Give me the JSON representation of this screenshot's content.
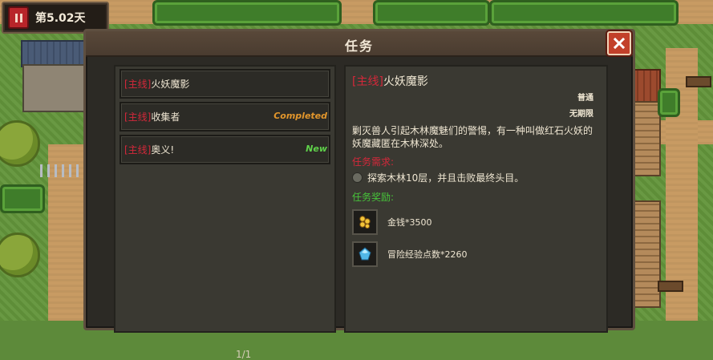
{
  "hud": {
    "day_label": "第5.02天"
  },
  "dialog": {
    "title": "任务",
    "close_icon": "close-icon"
  },
  "quests": [
    {
      "tag": "[主线]",
      "name": "火妖魔影",
      "status": ""
    },
    {
      "tag": "[主线]",
      "name": "收集者",
      "status": "Completed"
    },
    {
      "tag": "[主线]",
      "name": "奥义!",
      "status": "New"
    }
  ],
  "pager": "1/1",
  "detail": {
    "tag": "[主线]",
    "title": "火妖魔影",
    "type": "普通",
    "limit": "无期限",
    "description": "剿灭兽人引起木林魔魅们的警惕，有一种叫做红石火妖的妖魔藏匿在木林深处。",
    "requirements_label": "任务需求:",
    "requirement": "探索木林10层，并且击败最终头目。",
    "rewards_label": "任务奖励:",
    "rewards": [
      {
        "icon": "gold-coins-icon",
        "label": "金钱*3500"
      },
      {
        "icon": "blue-crystal-icon",
        "label": "冒险经验点数*2260"
      }
    ]
  },
  "colors": {
    "tag_red": "#d4283a",
    "completed_orange": "#e2962c",
    "new_green": "#5fd14a",
    "rewards_green": "#47c43a"
  }
}
